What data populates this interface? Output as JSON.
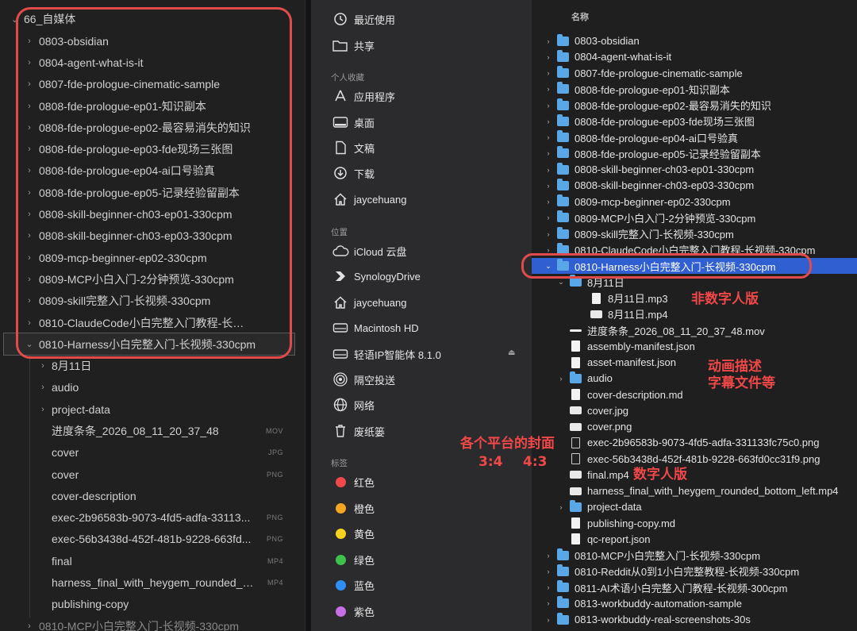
{
  "explorer": {
    "root": "66_自媒体",
    "items": [
      {
        "label": "0803-obsidian",
        "type": "folder",
        "depth": 0
      },
      {
        "label": "0804-agent-what-is-it",
        "type": "folder",
        "depth": 0
      },
      {
        "label": "0807-fde-prologue-cinematic-sample",
        "type": "folder",
        "depth": 0
      },
      {
        "label": "0808-fde-prologue-ep01-知识副本",
        "type": "folder",
        "depth": 0
      },
      {
        "label": "0808-fde-prologue-ep02-最容易消失的知识",
        "type": "folder",
        "depth": 0
      },
      {
        "label": "0808-fde-prologue-ep03-fde现场三张图",
        "type": "folder",
        "depth": 0
      },
      {
        "label": "0808-fde-prologue-ep04-ai口号验真",
        "type": "folder",
        "depth": 0
      },
      {
        "label": "0808-fde-prologue-ep05-记录经验留副本",
        "type": "folder",
        "depth": 0
      },
      {
        "label": "0808-skill-beginner-ch03-ep01-330cpm",
        "type": "folder",
        "depth": 0
      },
      {
        "label": "0808-skill-beginner-ch03-ep03-330cpm",
        "type": "folder",
        "depth": 0
      },
      {
        "label": "0809-mcp-beginner-ep02-330cpm",
        "type": "folder",
        "depth": 0
      },
      {
        "label": "0809-MCP小白入门-2分钟预览-330cpm",
        "type": "folder",
        "depth": 0
      },
      {
        "label": "0809-skill完整入门-长视频-330cpm",
        "type": "folder",
        "depth": 0
      },
      {
        "label": "0810-ClaudeCode小白完整入门教程-长视频-330c...",
        "type": "folder",
        "depth": 0
      },
      {
        "label": "0810-Harness小白完整入门-长视频-330cpm",
        "type": "folder-open",
        "depth": 0,
        "selected": true
      },
      {
        "label": "8月11日",
        "type": "folder",
        "depth": 1
      },
      {
        "label": "audio",
        "type": "folder",
        "depth": 1
      },
      {
        "label": "project-data",
        "type": "folder",
        "depth": 1
      },
      {
        "label": "进度条条_2026_08_11_20_37_48",
        "type": "file",
        "depth": 1,
        "ext": "MOV"
      },
      {
        "label": "cover",
        "type": "file",
        "depth": 1,
        "ext": "JPG"
      },
      {
        "label": "cover",
        "type": "file",
        "depth": 1,
        "ext": "PNG"
      },
      {
        "label": "cover-description",
        "type": "file",
        "depth": 1,
        "ext": ""
      },
      {
        "label": "exec-2b96583b-9073-4fd5-adfa-33113...",
        "type": "file",
        "depth": 1,
        "ext": "PNG"
      },
      {
        "label": "exec-56b3438d-452f-481b-9228-663fd...",
        "type": "file",
        "depth": 1,
        "ext": "PNG"
      },
      {
        "label": "final",
        "type": "file",
        "depth": 1,
        "ext": "MP4"
      },
      {
        "label": "harness_final_with_heygem_rounded_bo...",
        "type": "file",
        "depth": 1,
        "ext": "MP4"
      },
      {
        "label": "publishing-copy",
        "type": "file",
        "depth": 1,
        "ext": ""
      },
      {
        "label": "0810-MCP小白完整入门-长视频-330cpm",
        "type": "folder",
        "depth": 0,
        "cut": true
      }
    ]
  },
  "sidebar": {
    "favorites": [
      {
        "label": "最近使用",
        "icon": "clock-icon"
      },
      {
        "label": "共享",
        "icon": "shared-folder-icon"
      }
    ],
    "personal_header": "个人收藏",
    "personal": [
      {
        "label": "应用程序",
        "icon": "applications-icon"
      },
      {
        "label": "桌面",
        "icon": "desktop-icon"
      },
      {
        "label": "文稿",
        "icon": "document-icon"
      },
      {
        "label": "下载",
        "icon": "download-icon"
      },
      {
        "label": "jaycehuang",
        "icon": "home-icon"
      }
    ],
    "locations_header": "位置",
    "locations": [
      {
        "label": "iCloud 云盘",
        "icon": "cloud-icon"
      },
      {
        "label": "SynologyDrive",
        "icon": "synology-icon"
      },
      {
        "label": "jaycehuang",
        "icon": "home-icon"
      },
      {
        "label": "Macintosh HD",
        "icon": "disk-icon"
      },
      {
        "label": "轻语IP智能体 8.1.0",
        "icon": "disk-icon"
      },
      {
        "label": "隔空投送",
        "icon": "airdrop-icon"
      },
      {
        "label": "网络",
        "icon": "network-icon"
      },
      {
        "label": "废纸篓",
        "icon": "trash-icon"
      }
    ],
    "tags_header": "标签",
    "tags": [
      {
        "label": "红色",
        "color": "#f0494c"
      },
      {
        "label": "橙色",
        "color": "#f5a623"
      },
      {
        "label": "黄色",
        "color": "#f7d21e"
      },
      {
        "label": "绿色",
        "color": "#3ec24c"
      },
      {
        "label": "蓝色",
        "color": "#2f8ef5"
      },
      {
        "label": "紫色",
        "color": "#c86ee6"
      }
    ]
  },
  "list": {
    "header": "名称",
    "rows": [
      {
        "label": "0803-obsidian",
        "kind": "folder",
        "indent": 0,
        "chev": "›"
      },
      {
        "label": "0804-agent-what-is-it",
        "kind": "folder",
        "indent": 0,
        "chev": "›"
      },
      {
        "label": "0807-fde-prologue-cinematic-sample",
        "kind": "folder",
        "indent": 0,
        "chev": "›"
      },
      {
        "label": "0808-fde-prologue-ep01-知识副本",
        "kind": "folder",
        "indent": 0,
        "chev": "›"
      },
      {
        "label": "0808-fde-prologue-ep02-最容易消失的知识",
        "kind": "folder",
        "indent": 0,
        "chev": "›"
      },
      {
        "label": "0808-fde-prologue-ep03-fde现场三张图",
        "kind": "folder",
        "indent": 0,
        "chev": "›"
      },
      {
        "label": "0808-fde-prologue-ep04-ai口号验真",
        "kind": "folder",
        "indent": 0,
        "chev": "›"
      },
      {
        "label": "0808-fde-prologue-ep05-记录经验留副本",
        "kind": "folder",
        "indent": 0,
        "chev": "›"
      },
      {
        "label": "0808-skill-beginner-ch03-ep01-330cpm",
        "kind": "folder",
        "indent": 0,
        "chev": "›"
      },
      {
        "label": "0808-skill-beginner-ch03-ep03-330cpm",
        "kind": "folder",
        "indent": 0,
        "chev": "›"
      },
      {
        "label": "0809-mcp-beginner-ep02-330cpm",
        "kind": "folder",
        "indent": 0,
        "chev": "›"
      },
      {
        "label": "0809-MCP小白入门-2分钟预览-330cpm",
        "kind": "folder",
        "indent": 0,
        "chev": "›"
      },
      {
        "label": "0809-skill完整入门-长视频-330cpm",
        "kind": "folder",
        "indent": 0,
        "chev": "›"
      },
      {
        "label": "0810-ClaudeCode小白完整入门教程-长视频-330cpm",
        "kind": "folder",
        "indent": 0,
        "chev": "›"
      },
      {
        "label": "0810-Harness小白完整入门-长视频-330cpm",
        "kind": "folder",
        "indent": 0,
        "chev": "⌄",
        "selected": true
      },
      {
        "label": "8月11日",
        "kind": "folder",
        "indent": 1,
        "chev": "⌄"
      },
      {
        "label": "8月11日.mp3",
        "kind": "doc",
        "indent": 2,
        "chev": ""
      },
      {
        "label": "8月11日.mp4",
        "kind": "img",
        "indent": 2,
        "chev": ""
      },
      {
        "label": "进度条条_2026_08_11_20_37_48.mov",
        "kind": "bar",
        "indent": 1,
        "chev": ""
      },
      {
        "label": "assembly-manifest.json",
        "kind": "doc",
        "indent": 1,
        "chev": ""
      },
      {
        "label": "asset-manifest.json",
        "kind": "doc",
        "indent": 1,
        "chev": ""
      },
      {
        "label": "audio",
        "kind": "folder",
        "indent": 1,
        "chev": "›"
      },
      {
        "label": "cover-description.md",
        "kind": "doc",
        "indent": 1,
        "chev": ""
      },
      {
        "label": "cover.jpg",
        "kind": "img",
        "indent": 1,
        "chev": ""
      },
      {
        "label": "cover.png",
        "kind": "img",
        "indent": 1,
        "chev": ""
      },
      {
        "label": "exec-2b96583b-9073-4fd5-adfa-331133fc75c0.png",
        "kind": "vid",
        "indent": 1,
        "chev": ""
      },
      {
        "label": "exec-56b3438d-452f-481b-9228-663fd0cc31f9.png",
        "kind": "vid",
        "indent": 1,
        "chev": ""
      },
      {
        "label": "final.mp4",
        "kind": "img",
        "indent": 1,
        "chev": ""
      },
      {
        "label": "harness_final_with_heygem_rounded_bottom_left.mp4",
        "kind": "img",
        "indent": 1,
        "chev": ""
      },
      {
        "label": "project-data",
        "kind": "folder",
        "indent": 1,
        "chev": "›"
      },
      {
        "label": "publishing-copy.md",
        "kind": "doc",
        "indent": 1,
        "chev": ""
      },
      {
        "label": "qc-report.json",
        "kind": "doc",
        "indent": 1,
        "chev": ""
      },
      {
        "label": "0810-MCP小白完整入门-长视频-330cpm",
        "kind": "folder",
        "indent": 0,
        "chev": "›"
      },
      {
        "label": "0810-Reddit从0到1小白完整教程-长视频-330cpm",
        "kind": "folder",
        "indent": 0,
        "chev": "›"
      },
      {
        "label": "0811-AI术语小白完整入门教程-长视频-300cpm",
        "kind": "folder",
        "indent": 0,
        "chev": "›"
      },
      {
        "label": "0813-workbuddy-automation-sample",
        "kind": "folder",
        "indent": 0,
        "chev": "›"
      },
      {
        "label": "0813-workbuddy-real-screenshots-30s",
        "kind": "folder",
        "indent": 0,
        "chev": "›"
      }
    ]
  },
  "annotations": {
    "non_digital_human": "非数字人版",
    "anim_desc_line1": "动画描述",
    "anim_desc_line2": "字幕文件等",
    "covers_line1": "各个平台的封面",
    "covers_ratio_a": "3:4",
    "covers_ratio_b": "4:3",
    "digital_human": "数字人版"
  },
  "colors": {
    "annotation_red": "#e14b4b",
    "selection_blue": "#2f5fd1",
    "folder_blue": "#5aa7e8"
  }
}
